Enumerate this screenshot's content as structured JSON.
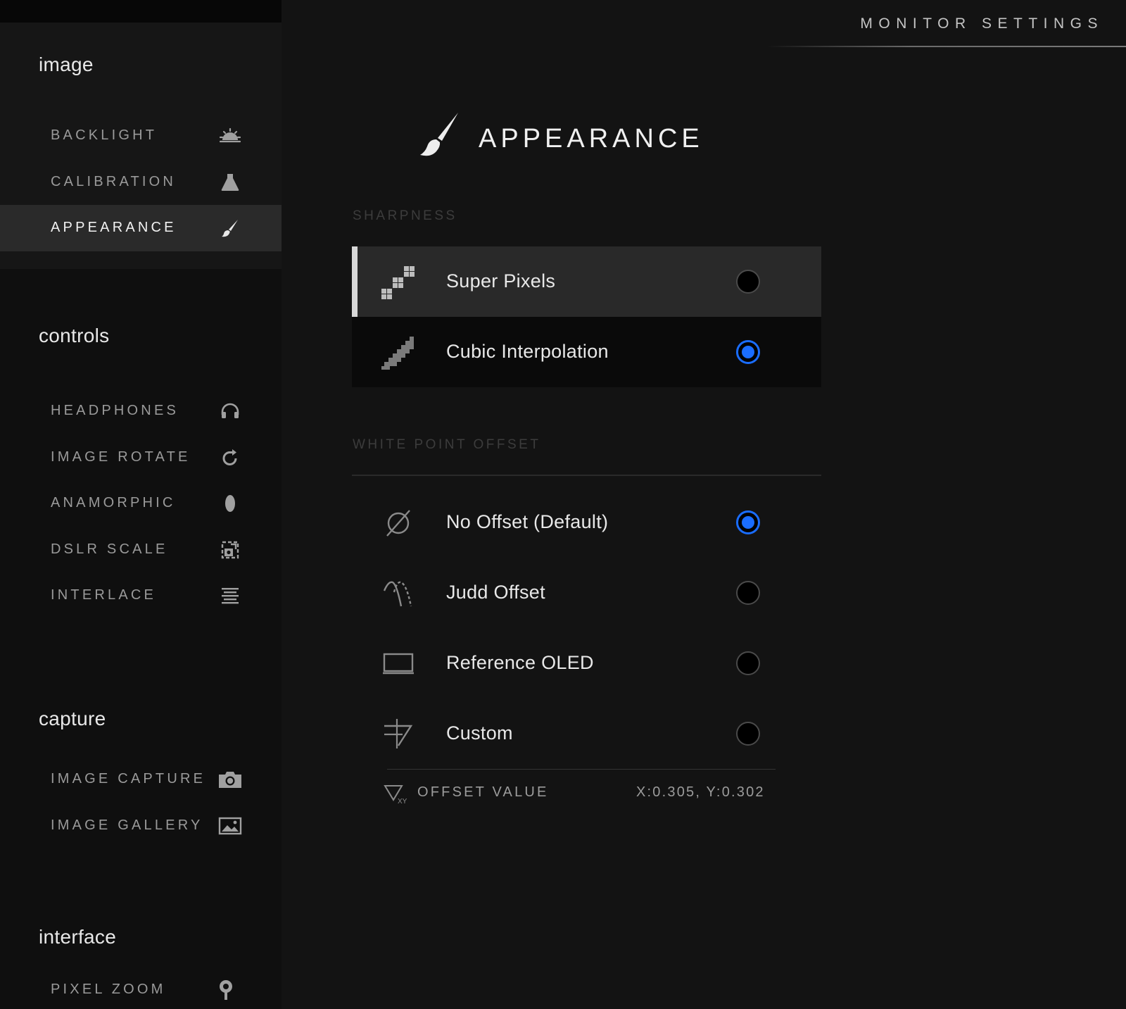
{
  "app": {
    "title": "MONITOR SETTINGS"
  },
  "sidebar": {
    "groups": [
      {
        "title": "image",
        "items": [
          {
            "label": "BACKLIGHT",
            "icon": "backlight-icon"
          },
          {
            "label": "CALIBRATION",
            "icon": "calibration-icon"
          },
          {
            "label": "APPEARANCE",
            "icon": "brush-icon",
            "active": true
          }
        ]
      },
      {
        "title": "controls",
        "items": [
          {
            "label": "HEADPHONES",
            "icon": "headphones-icon"
          },
          {
            "label": "IMAGE ROTATE",
            "icon": "rotate-icon"
          },
          {
            "label": "ANAMORPHIC",
            "icon": "anamorphic-icon"
          },
          {
            "label": "DSLR SCALE",
            "icon": "dslr-scale-icon"
          },
          {
            "label": "INTERLACE",
            "icon": "interlace-icon"
          }
        ]
      },
      {
        "title": "capture",
        "items": [
          {
            "label": "IMAGE CAPTURE",
            "icon": "camera-icon"
          },
          {
            "label": "IMAGE GALLERY",
            "icon": "gallery-icon"
          }
        ]
      },
      {
        "title": "interface",
        "items": [
          {
            "label": "PIXEL ZOOM",
            "icon": "pixel-zoom-icon"
          }
        ]
      }
    ]
  },
  "main": {
    "title": "APPEARANCE",
    "title_icon": "brush-icon",
    "sharpness": {
      "label": "SHARPNESS",
      "options": [
        {
          "label": "Super Pixels",
          "icon": "super-pixels-icon",
          "selected": false,
          "highlighted": true
        },
        {
          "label": "Cubic Interpolation",
          "icon": "cubic-interpolation-icon",
          "selected": true
        }
      ]
    },
    "white_point_offset": {
      "label": "WHITE POINT OFFSET",
      "options": [
        {
          "label": "No Offset (Default)",
          "icon": "no-offset-icon",
          "selected": true
        },
        {
          "label": "Judd Offset",
          "icon": "judd-offset-icon",
          "selected": false
        },
        {
          "label": "Reference OLED",
          "icon": "oled-monitor-icon",
          "selected": false
        },
        {
          "label": "Custom",
          "icon": "custom-offset-icon",
          "selected": false
        }
      ],
      "offset_value_label": "OFFSET VALUE",
      "offset_value": "X:0.305, Y:0.302"
    }
  },
  "colors": {
    "accent": "#1a6dff",
    "background": "#131313",
    "sidebar": "#0f0f0f",
    "active_item": "#2a2a2a"
  }
}
